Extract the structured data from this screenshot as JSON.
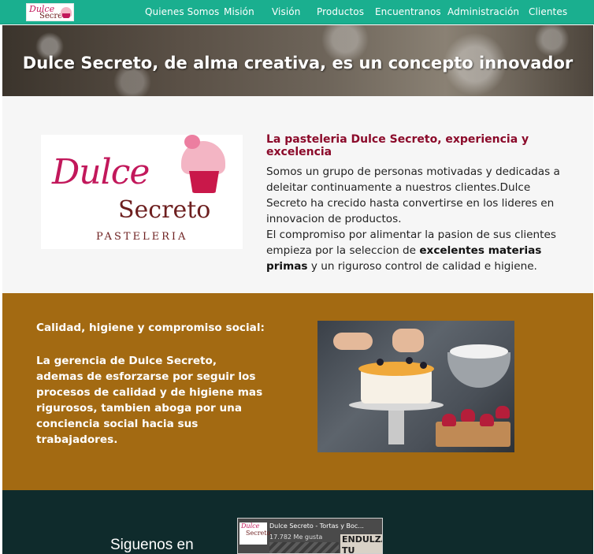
{
  "navbar": {
    "logo": {
      "line1": "Dulce",
      "line2": "Secreto"
    },
    "links": [
      "Quienes Somos",
      "Misión",
      "Visión",
      "Productos",
      "Encuentranos",
      "Administración",
      "Clientes"
    ]
  },
  "hero": {
    "title": "Dulce Secreto, de alma creativa, es un concepto innovador"
  },
  "about": {
    "logo": {
      "line1": "Dulce",
      "line2": "Secreto",
      "line3": "PASTELERIA"
    },
    "heading": "La pasteleria Dulce Secreto, experiencia y excelencia",
    "paragraph1": "Somos un grupo de personas motivadas y dedicadas a deleitar continuamente a nuestros clientes.Dulce Secreto ha crecido hasta convertirse en los lideres en innovacion de productos.",
    "paragraph2_before": "El compromiso por alimentar la pasion de sus clientes empieza por la seleccion de ",
    "paragraph2_bold": "excelentes materias primas",
    "paragraph2_after": " y un riguroso control de calidad e higiene."
  },
  "quality": {
    "heading": "Calidad, higiene y compromiso social:",
    "text": "La gerencia de Dulce Secreto, ademas de esforzarse por seguir los procesos de calidad y de higiene mas rigurosos, tambien aboga por una conciencia social hacia sus trabajadores."
  },
  "footer": {
    "follow_text": "Siguenos en",
    "facebook": {
      "logo_line1": "Dulce",
      "logo_line2": "Secreto",
      "page_name": "Dulce Secreto - Tortas y Boc...",
      "likes": "17.782 Me gusta",
      "banner_line1": "ENDULZA",
      "banner_line2": "TU VIDA"
    }
  },
  "colors": {
    "navbar": "#1aaf8f",
    "heading_accent": "#8b0a2a",
    "quality_bg": "#a36a12",
    "footer_bg": "#0f2b2c"
  }
}
